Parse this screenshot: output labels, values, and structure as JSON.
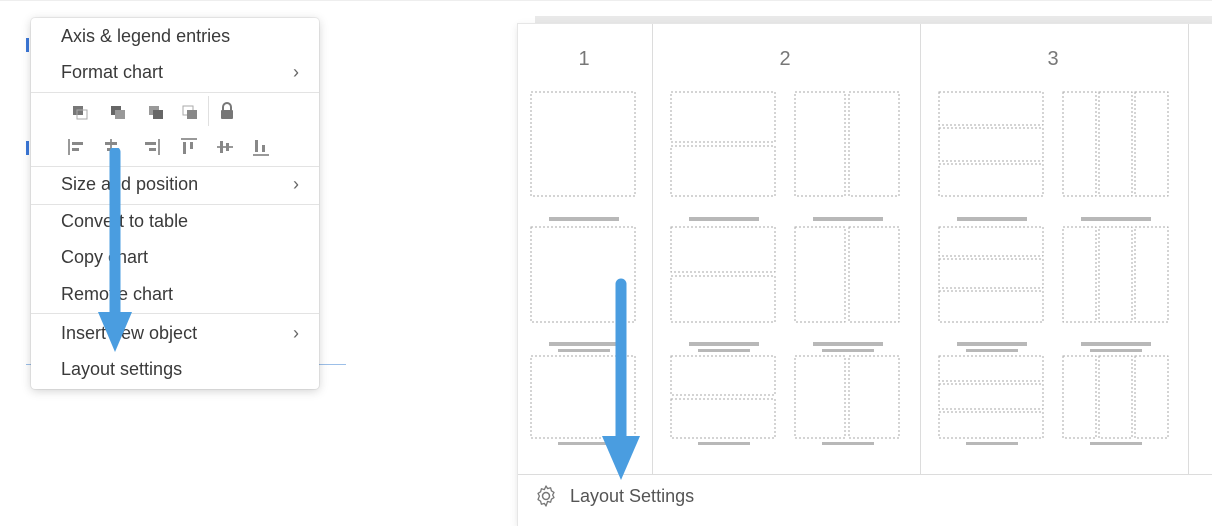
{
  "context_menu": {
    "items": {
      "axis_legend": "Axis & legend entries",
      "format_chart": "Format chart",
      "size_position": "Size and position",
      "convert_table": "Convert to table",
      "copy_chart": "Copy chart",
      "remove_chart": "Remove chart",
      "insert_new_object": "Insert new object",
      "layout_settings": "Layout settings"
    },
    "submenu_chevron": "›"
  },
  "layout_panel": {
    "columns": [
      "1",
      "2",
      "3"
    ],
    "footer_label": "Layout Settings",
    "footer_icon": "gear-icon"
  },
  "colors": {
    "arrow": "#4a9de0",
    "dashed_box": "#aaaaaa",
    "bar": "#b8b8b8"
  }
}
